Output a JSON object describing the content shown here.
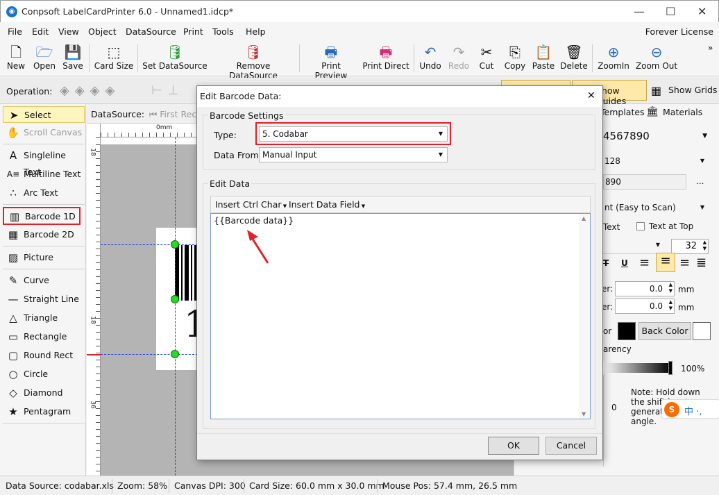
{
  "window": {
    "title": "Conpsoft LabelCardPrinter 6.0 - Unnamed1.idcp*",
    "minimize": "—",
    "maximize": "☐",
    "close": "✕"
  },
  "menu": [
    "File",
    "Edit",
    "View",
    "Object",
    "DataSource",
    "Print",
    "Tools",
    "Help"
  ],
  "license": "Forever License",
  "toolbar": [
    {
      "label": "New",
      "icon": "new-file-icon",
      "glyph": "🗋"
    },
    {
      "label": "Open",
      "icon": "open-icon",
      "glyph": "🗁"
    },
    {
      "label": "Save",
      "icon": "save-icon",
      "glyph": "💾"
    },
    {
      "label": "Card Size",
      "icon": "card-size-icon",
      "glyph": "⬚"
    },
    {
      "label": "Set DataSource",
      "icon": "database-icon",
      "glyph": "🛢"
    },
    {
      "label": "Remove DataSource",
      "icon": "remove-database-icon",
      "glyph": "🛢"
    },
    {
      "label": "Print Preview",
      "icon": "print-preview-icon",
      "glyph": "🖶"
    },
    {
      "label": "Print Direct",
      "icon": "print-icon",
      "glyph": "🖶"
    },
    {
      "label": "Undo",
      "icon": "undo-icon",
      "glyph": "↶"
    },
    {
      "label": "Redo",
      "icon": "redo-icon",
      "glyph": "↷"
    },
    {
      "label": "Cut",
      "icon": "cut-icon",
      "glyph": "✂"
    },
    {
      "label": "Copy",
      "icon": "copy-icon",
      "glyph": "⎘"
    },
    {
      "label": "Paste",
      "icon": "paste-icon",
      "glyph": "📋"
    },
    {
      "label": "Delete",
      "icon": "trash-icon",
      "glyph": "🗑"
    },
    {
      "label": "ZoomIn",
      "icon": "zoom-in-icon",
      "glyph": "⊕"
    },
    {
      "label": "Zoom Out",
      "icon": "zoom-out-icon",
      "glyph": "⊖"
    }
  ],
  "opbar": {
    "label": "Operation:",
    "show_guides": "Show Guides",
    "show_grids": "Show Grids",
    "overflow": "»"
  },
  "tools": [
    {
      "label": "Select",
      "icon": "cursor-icon",
      "glyph": "➤"
    },
    {
      "label": "Scroll Canvas",
      "icon": "hand-icon",
      "glyph": "✋"
    },
    {
      "label": "Singleline Text",
      "icon": "singleline-text-icon",
      "glyph": "A"
    },
    {
      "label": "Multiline Text",
      "icon": "multiline-text-icon",
      "glyph": "A≡"
    },
    {
      "label": "Arc Text",
      "icon": "arc-text-icon",
      "glyph": "∴"
    },
    {
      "label": "Barcode 1D",
      "icon": "barcode-icon",
      "glyph": "▥"
    },
    {
      "label": "Barcode 2D",
      "icon": "qrcode-icon",
      "glyph": "▦"
    },
    {
      "label": "Picture",
      "icon": "picture-icon",
      "glyph": "▨"
    },
    {
      "label": "Curve",
      "icon": "curve-icon",
      "glyph": "✎"
    },
    {
      "label": "Straight Line",
      "icon": "line-icon",
      "glyph": "—"
    },
    {
      "label": "Triangle",
      "icon": "triangle-icon",
      "glyph": "△"
    },
    {
      "label": "Rectangle",
      "icon": "rectangle-icon",
      "glyph": "▭"
    },
    {
      "label": "Round Rect",
      "icon": "round-rect-icon",
      "glyph": "▢"
    },
    {
      "label": "Circle",
      "icon": "circle-icon",
      "glyph": "○"
    },
    {
      "label": "Diamond",
      "icon": "diamond-icon",
      "glyph": "◇"
    },
    {
      "label": "Pentagram",
      "icon": "star-icon",
      "glyph": "★"
    }
  ],
  "datasource": {
    "label": "DataSource:",
    "first_record": "First Rec"
  },
  "ruler": {
    "top_zero": "0mm",
    "left_marks": [
      "18",
      "18",
      "36"
    ]
  },
  "canvas_digit": "1",
  "right": {
    "tab_templates": "Templates",
    "tab_materials": "Materials",
    "data_value": "4567890",
    "symbology": "128",
    "data2": "890",
    "ellipsis": "...",
    "font_option": "nt (Easy to Scan)",
    "text_label": "Text",
    "text_at_top": "Text at Top",
    "font_size": "32",
    "fmt_t": "T",
    "fmt_u": "U",
    "offset1_label": "er:",
    "offset1": "0.0",
    "offset2_label": "er:",
    "offset2": "0.0",
    "unit": "mm",
    "fore_color": "or",
    "back_color": "Back Color",
    "transparency": "arency",
    "opacity": "100%",
    "rotation_value": "0",
    "note": "Note: Hold down the shift key to generate multiple angle.",
    "ime": "中 ·,"
  },
  "status": [
    "Data Source: codabar.xls",
    "Zoom: 58%",
    "Canvas DPI: 300",
    "Card Size: 60.0 mm x 30.0 mm",
    "Mouse Pos: 57.4 mm, 26.5 mm"
  ],
  "dialog": {
    "title": "Edit Barcode Data:",
    "close": "✕",
    "settings_group": "Barcode Settings",
    "type_label": "Type:",
    "type_value": "5.  Codabar",
    "datafrom_label": "Data From:",
    "datafrom_value": "Manual Input",
    "edit_group": "Edit Data",
    "insert_ctrl": "Insert Ctrl Char",
    "insert_field": "Insert Data Field",
    "content": "{{Barcode data}}",
    "ok": "OK",
    "cancel": "Cancel"
  },
  "colors": {
    "highlight": "#e0202a",
    "handle": "#22dd22",
    "select_bg": "#fff6bf"
  }
}
